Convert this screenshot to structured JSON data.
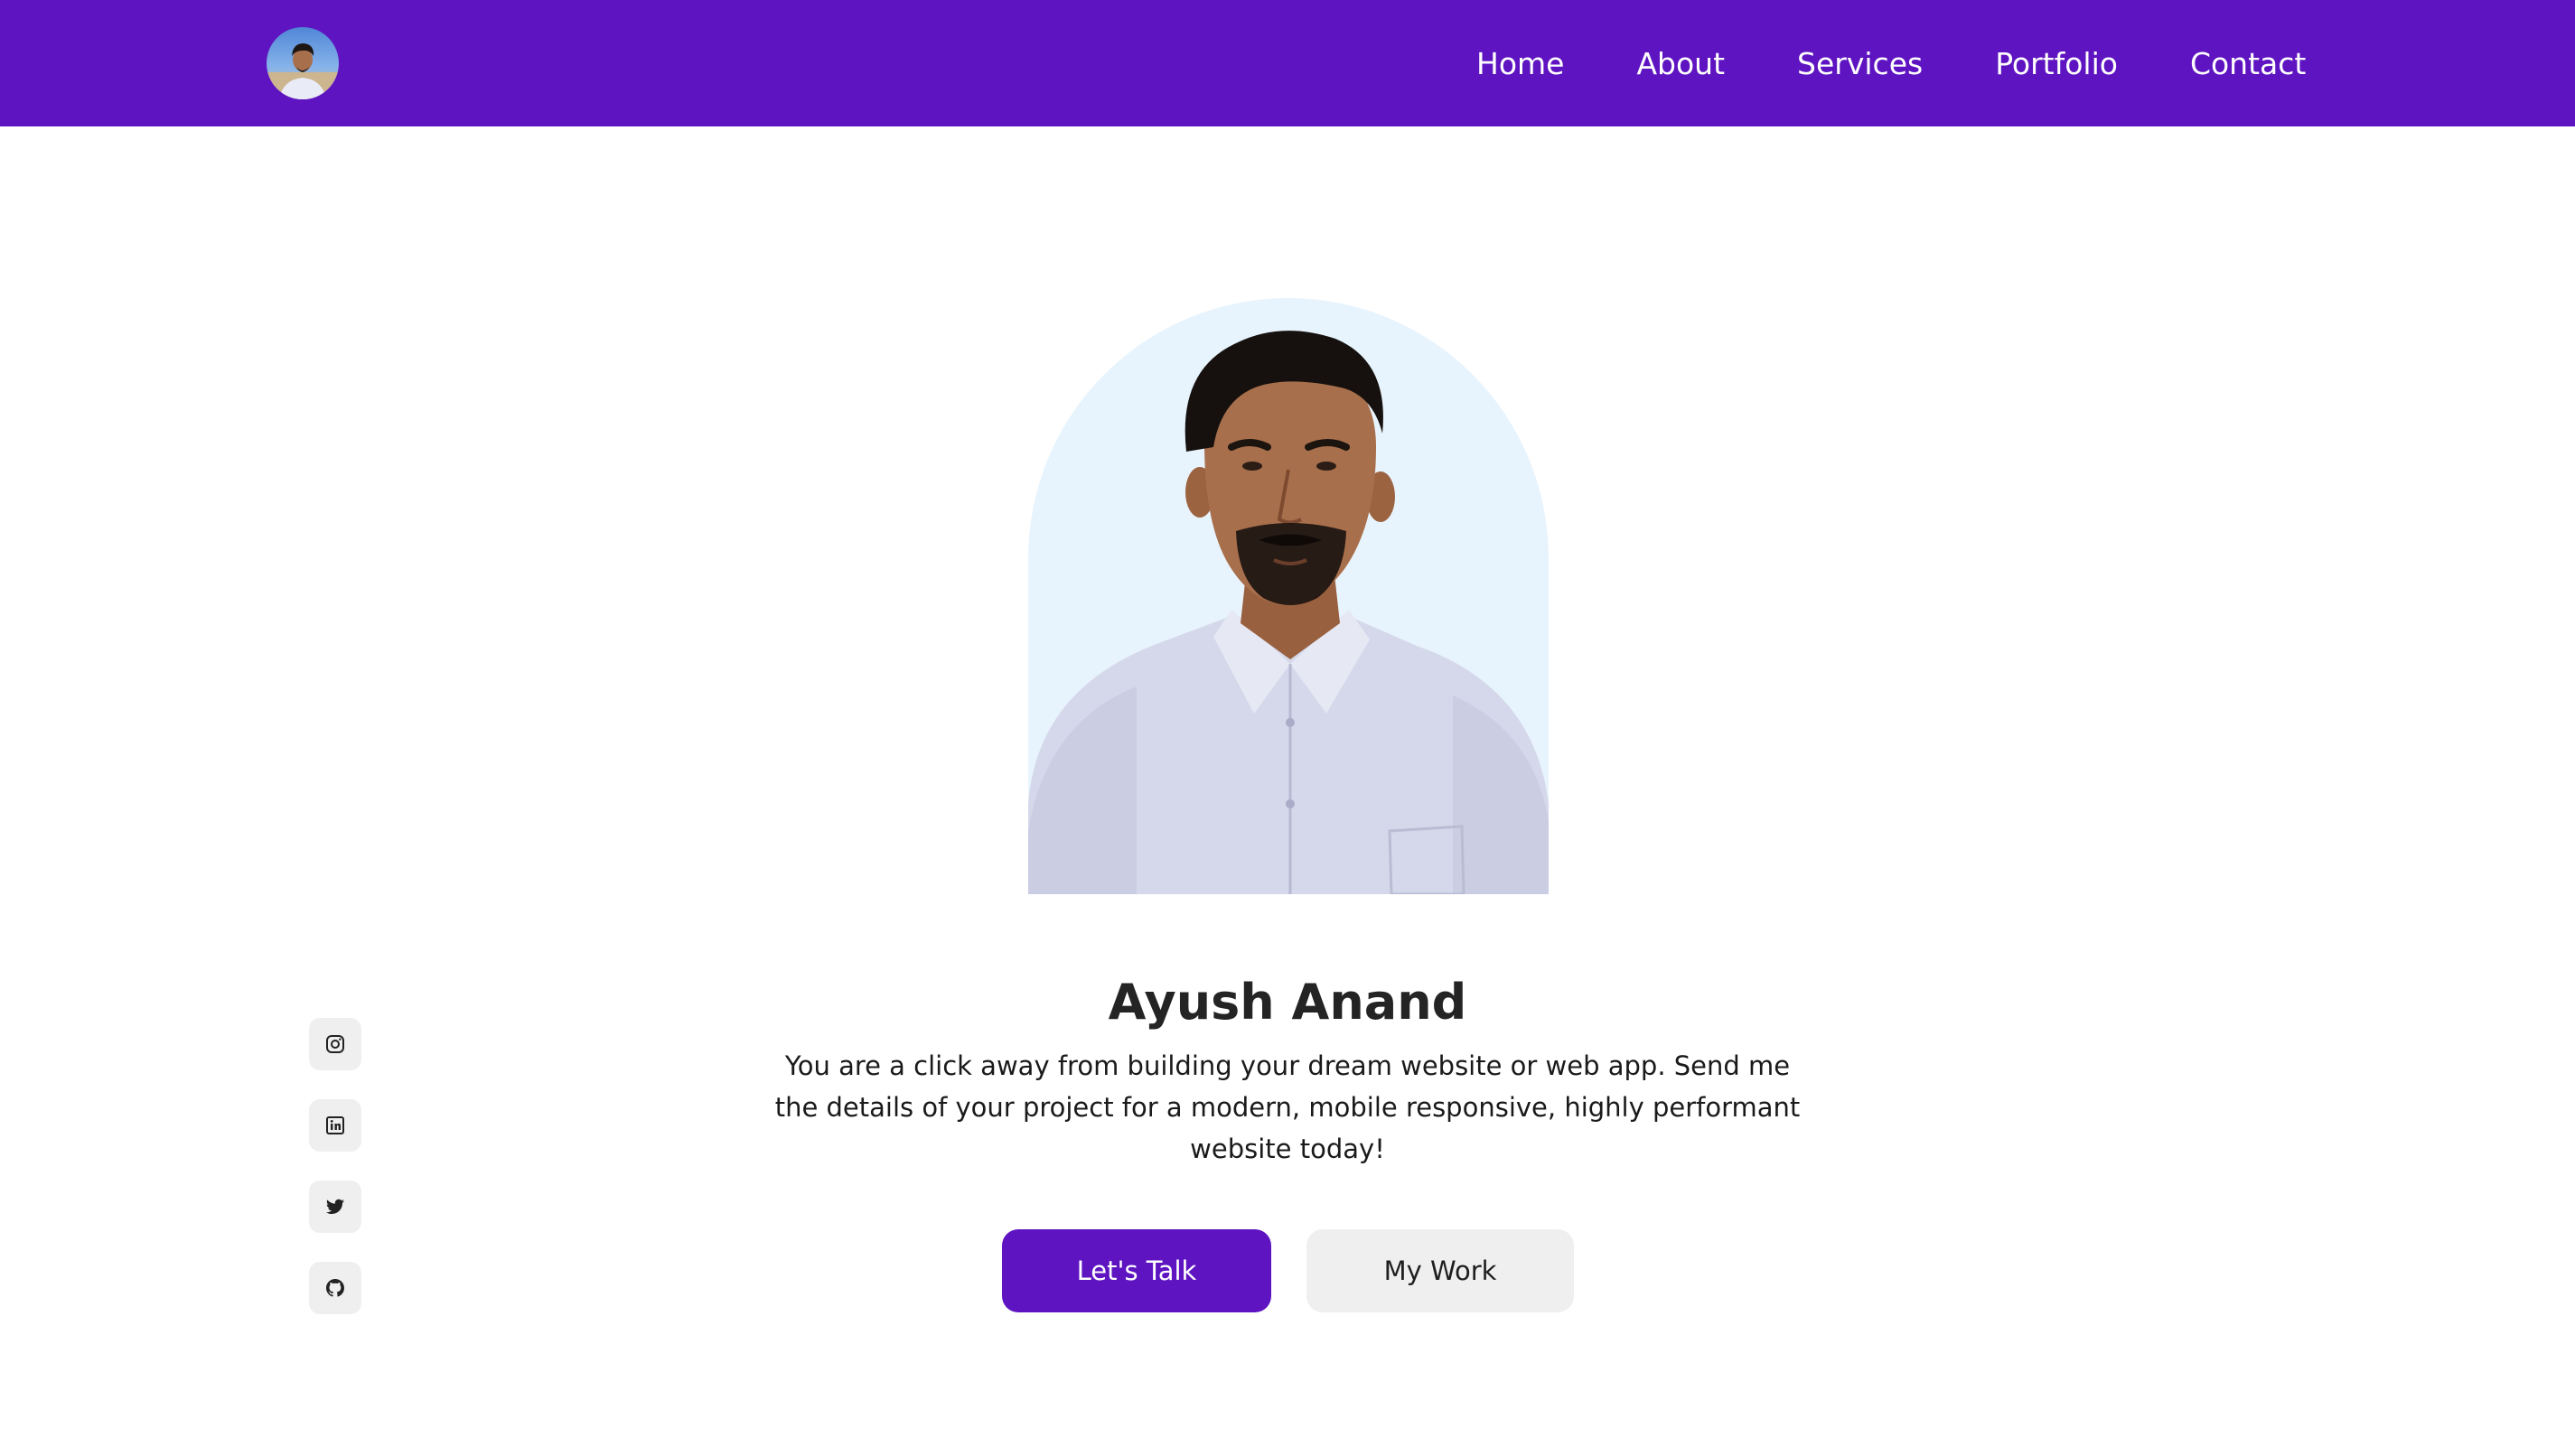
{
  "colors": {
    "brand": "#5f14c1",
    "portrait_bg": "#e8f4fd",
    "secondary_button_bg": "#efefef",
    "text": "#242424"
  },
  "header": {
    "logo_icon": "profile-avatar",
    "nav": [
      {
        "label": "Home"
      },
      {
        "label": "About"
      },
      {
        "label": "Services"
      },
      {
        "label": "Portfolio"
      },
      {
        "label": "Contact"
      }
    ]
  },
  "hero": {
    "portrait_icon": "profile-photo",
    "name": "Ayush Anand",
    "description": "You are a click away from building your dream website or web app. Send me the details of your project for a modern, mobile responsive, highly performant website today!",
    "primary_button": "Let's Talk",
    "secondary_button": "My Work"
  },
  "socials": [
    {
      "icon": "instagram-icon"
    },
    {
      "icon": "linkedin-icon"
    },
    {
      "icon": "twitter-icon"
    },
    {
      "icon": "github-icon"
    }
  ]
}
